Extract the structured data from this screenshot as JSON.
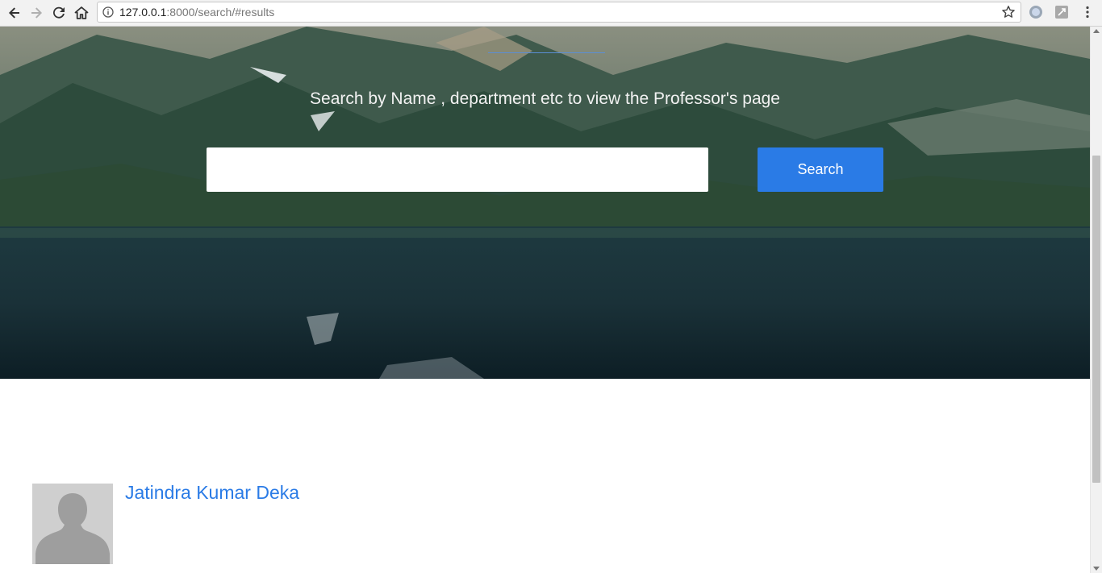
{
  "browser": {
    "url_host": "127.0.0.1",
    "url_path": ":8000/search/#results"
  },
  "hero": {
    "tagline": "Search by Name , department etc to view the Professor's page",
    "search_value": "",
    "search_button_label": "Search"
  },
  "results": [
    {
      "name": "Jatindra Kumar Deka"
    }
  ],
  "colors": {
    "accent": "#2a7be6",
    "avatar_bg": "#cfcfcf"
  }
}
